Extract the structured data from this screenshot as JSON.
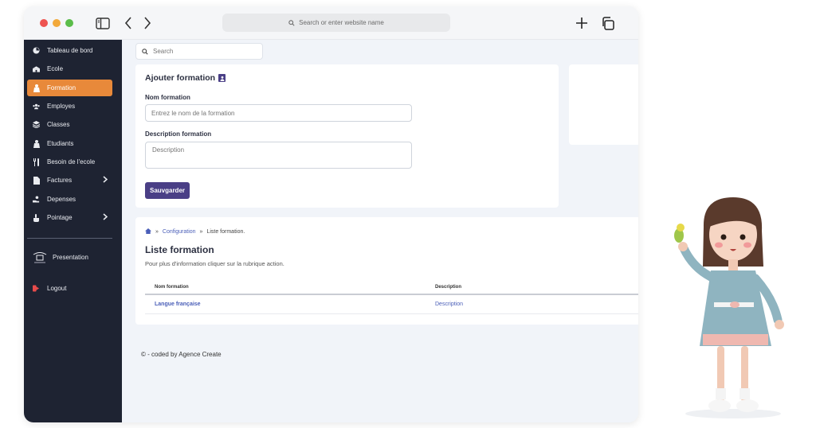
{
  "browser": {
    "address_placeholder": "Search or enter website name"
  },
  "sidebar": {
    "items": [
      {
        "label": "Tableau de bord",
        "icon": "dashboard-icon"
      },
      {
        "label": "Ecole",
        "icon": "school-icon"
      },
      {
        "label": "Formation",
        "icon": "graduation-icon",
        "active": true
      },
      {
        "label": "Employes",
        "icon": "users-icon"
      },
      {
        "label": "Classes",
        "icon": "layers-icon"
      },
      {
        "label": "Etudiants",
        "icon": "student-icon"
      },
      {
        "label": "Besoin de l'ecole",
        "icon": "utensils-icon"
      },
      {
        "label": "Factures",
        "icon": "file-icon",
        "has_submenu": true
      },
      {
        "label": "Depenses",
        "icon": "hand-money-icon"
      },
      {
        "label": "Pointage",
        "icon": "hand-pointer-icon",
        "has_submenu": true
      }
    ],
    "presentation_label": "Presentation",
    "logout_label": "Logout"
  },
  "main": {
    "search_placeholder": "Search",
    "form": {
      "title": "Ajouter formation",
      "name_label": "Nom formation",
      "name_placeholder": "Entrez le nom de la formation",
      "description_label": "Description formation",
      "description_placeholder": "Description",
      "save_label": "Sauvgarder"
    },
    "list": {
      "breadcrumb": {
        "sep": "»",
        "configuration": "Configuration",
        "current": "Liste formation."
      },
      "title": "Liste formation",
      "subtitle": "Pour plus d'information cliquer sur la rubrique action.",
      "columns": [
        "Nom formation",
        "Description"
      ],
      "rows": [
        {
          "name": "Langue française",
          "description": "Description"
        }
      ]
    },
    "footer": "© - coded by Agence Create"
  },
  "colors": {
    "sidebar_bg": "#1e2332",
    "active_item": "#e8893a",
    "primary_button": "#4a3f86",
    "link": "#4a5eb8",
    "content_bg": "#f1f4f9"
  }
}
